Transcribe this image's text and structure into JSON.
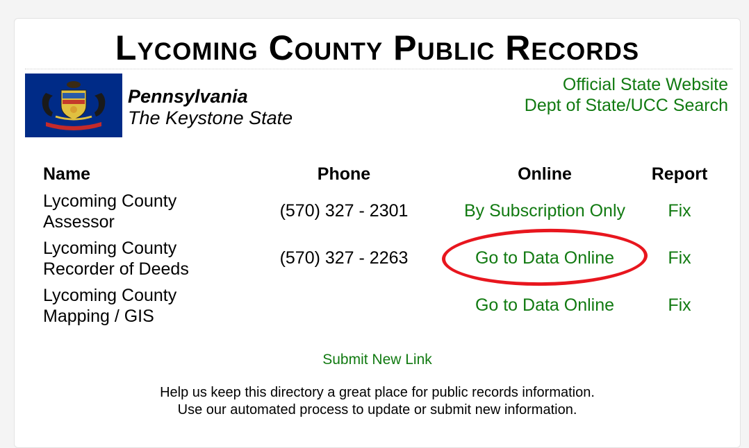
{
  "page": {
    "title": "Lycoming County Public Records"
  },
  "state": {
    "name": "Pennsylvania",
    "nickname": "The Keystone State",
    "links": [
      {
        "label": "Official State Website"
      },
      {
        "label": "Dept of State/UCC Search"
      }
    ]
  },
  "table": {
    "headers": {
      "name": "Name",
      "phone": "Phone",
      "online": "Online",
      "report": "Report"
    },
    "rows": [
      {
        "name_line1": "Lycoming County",
        "name_line2": "Assessor",
        "phone": "(570) 327 - 2301",
        "online": "By Subscription Only",
        "report": "Fix"
      },
      {
        "name_line1": "Lycoming County",
        "name_line2": "Recorder of Deeds",
        "phone": "(570) 327 - 2263",
        "online": "Go to Data Online",
        "report": "Fix"
      },
      {
        "name_line1": "Lycoming County",
        "name_line2": "Mapping / GIS",
        "phone": "",
        "online": "Go to Data Online",
        "report": "Fix"
      }
    ]
  },
  "footer": {
    "submit_label": "Submit New Link",
    "help_line1": "Help us keep this directory a great place for public records information.",
    "help_line2": "Use our automated process to update or submit new information."
  },
  "colors": {
    "link": "#117a11",
    "highlight": "#e8161e",
    "flag_blue": "#002b87"
  }
}
